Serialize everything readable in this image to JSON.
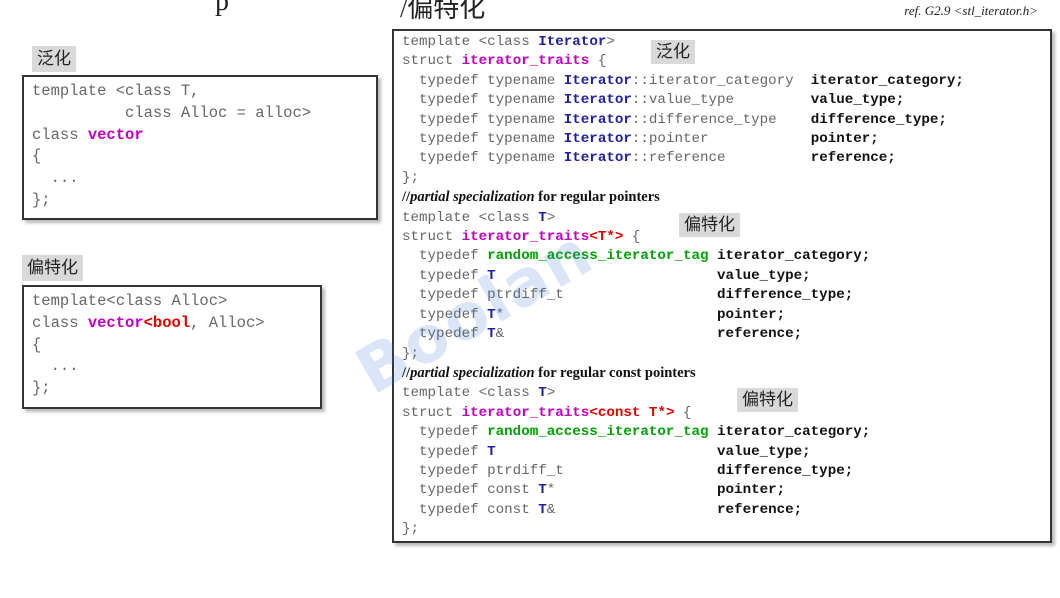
{
  "header": {
    "title_fragment_left": "p",
    "title_fragment_right": "/偏特化",
    "ref": "ref. G2.9  <stl_iterator.h>"
  },
  "left": {
    "generalization_label": "泛化",
    "generalization_code": [
      [
        [
          "kw",
          "template <class T,"
        ]
      ],
      [
        [
          "kw",
          "          class Alloc = alloc>"
        ]
      ],
      [
        [
          "kw",
          "class "
        ],
        [
          "cls",
          "vector"
        ]
      ],
      [
        [
          "kw",
          "{"
        ]
      ],
      [
        [
          "kw",
          "  ..."
        ]
      ],
      [
        [
          "kw",
          "};"
        ]
      ]
    ],
    "partial_label": "偏特化",
    "partial_code": [
      [
        [
          "kw",
          "template<class Alloc>"
        ]
      ],
      [
        [
          "kw",
          "class "
        ],
        [
          "cls",
          "vector"
        ],
        [
          "red",
          "<bool"
        ],
        [
          "kw",
          ", Alloc>"
        ]
      ],
      [
        [
          "kw",
          "{"
        ]
      ],
      [
        [
          "kw",
          "  ..."
        ]
      ],
      [
        [
          "kw",
          "};"
        ]
      ]
    ]
  },
  "right": {
    "badge_generalization": "泛化",
    "badge_partial_1": "偏特化",
    "badge_partial_2": "偏特化",
    "lines": [
      [
        [
          "kw",
          "template <class "
        ],
        [
          "blue",
          "Iterator"
        ],
        [
          "kw",
          ">"
        ]
      ],
      [
        [
          "kw",
          "struct "
        ],
        [
          "cls",
          "iterator_traits"
        ],
        [
          "kw",
          " {"
        ]
      ],
      [
        [
          "kw",
          "  typedef typename "
        ],
        [
          "blue",
          "Iterator"
        ],
        [
          "kw",
          "::iterator_category  "
        ],
        [
          "blk",
          "iterator_category;"
        ]
      ],
      [
        [
          "kw",
          "  typedef typename "
        ],
        [
          "blue",
          "Iterator"
        ],
        [
          "kw",
          "::value_type         "
        ],
        [
          "blk",
          "value_type;"
        ]
      ],
      [
        [
          "kw",
          "  typedef typename "
        ],
        [
          "blue",
          "Iterator"
        ],
        [
          "kw",
          "::difference_type    "
        ],
        [
          "blk",
          "difference_type;"
        ]
      ],
      [
        [
          "kw",
          "  typedef typename "
        ],
        [
          "blue",
          "Iterator"
        ],
        [
          "kw",
          "::pointer            "
        ],
        [
          "blk",
          "pointer;"
        ]
      ],
      [
        [
          "kw",
          "  typedef typename "
        ],
        [
          "blue",
          "Iterator"
        ],
        [
          "kw",
          "::reference          "
        ],
        [
          "blk",
          "reference;"
        ]
      ],
      [
        [
          "kw",
          "};"
        ]
      ],
      [
        [
          "cmtpre",
          "//"
        ],
        [
          "cmti",
          "partial specialization"
        ],
        [
          "cmt",
          " for regular pointers"
        ]
      ],
      [
        [
          "kw",
          "template <class "
        ],
        [
          "blue",
          "T"
        ],
        [
          "kw",
          ">"
        ]
      ],
      [
        [
          "kw",
          "struct "
        ],
        [
          "cls",
          "iterator_traits"
        ],
        [
          "red",
          "<T*>"
        ],
        [
          "kw",
          " {"
        ]
      ],
      [
        [
          "kw",
          "  typedef "
        ],
        [
          "grn",
          "random_access_iterator_tag"
        ],
        [
          "kw",
          " "
        ],
        [
          "blk",
          "iterator_category;"
        ]
      ],
      [
        [
          "kw",
          "  typedef "
        ],
        [
          "blue",
          "T"
        ],
        [
          "kw",
          "                          "
        ],
        [
          "blk",
          "value_type;"
        ]
      ],
      [
        [
          "kw",
          "  typedef ptrdiff_t                  "
        ],
        [
          "blk",
          "difference_type;"
        ]
      ],
      [
        [
          "kw",
          "  typedef "
        ],
        [
          "blue",
          "T"
        ],
        [
          "kw",
          "*                         "
        ],
        [
          "blk",
          "pointer;"
        ]
      ],
      [
        [
          "kw",
          "  typedef "
        ],
        [
          "blue",
          "T"
        ],
        [
          "kw",
          "&                         "
        ],
        [
          "blk",
          "reference;"
        ]
      ],
      [
        [
          "kw",
          "};"
        ]
      ],
      [
        [
          "cmtpre",
          "//"
        ],
        [
          "cmti",
          "partial specialization"
        ],
        [
          "cmt",
          " for regular const pointers"
        ]
      ],
      [
        [
          "kw",
          "template <class "
        ],
        [
          "blue",
          "T"
        ],
        [
          "kw",
          ">"
        ]
      ],
      [
        [
          "kw",
          "struct "
        ],
        [
          "cls",
          "iterator_traits"
        ],
        [
          "red",
          "<const T*>"
        ],
        [
          "kw",
          " {"
        ]
      ],
      [
        [
          "kw",
          "  typedef "
        ],
        [
          "grn",
          "random_access_iterator_tag"
        ],
        [
          "kw",
          " "
        ],
        [
          "blk",
          "iterator_category;"
        ]
      ],
      [
        [
          "kw",
          "  typedef "
        ],
        [
          "blue",
          "T"
        ],
        [
          "kw",
          "                          "
        ],
        [
          "blk",
          "value_type;"
        ]
      ],
      [
        [
          "kw",
          "  typedef ptrdiff_t                  "
        ],
        [
          "blk",
          "difference_type;"
        ]
      ],
      [
        [
          "kw",
          "  typedef const "
        ],
        [
          "blue",
          "T"
        ],
        [
          "kw",
          "*                   "
        ],
        [
          "blk",
          "pointer;"
        ]
      ],
      [
        [
          "kw",
          "  typedef const "
        ],
        [
          "blue",
          "T"
        ],
        [
          "kw",
          "&                   "
        ],
        [
          "blk",
          "reference;"
        ]
      ],
      [
        [
          "kw",
          "};"
        ]
      ]
    ]
  },
  "watermark": {
    "text": "Boolan"
  }
}
